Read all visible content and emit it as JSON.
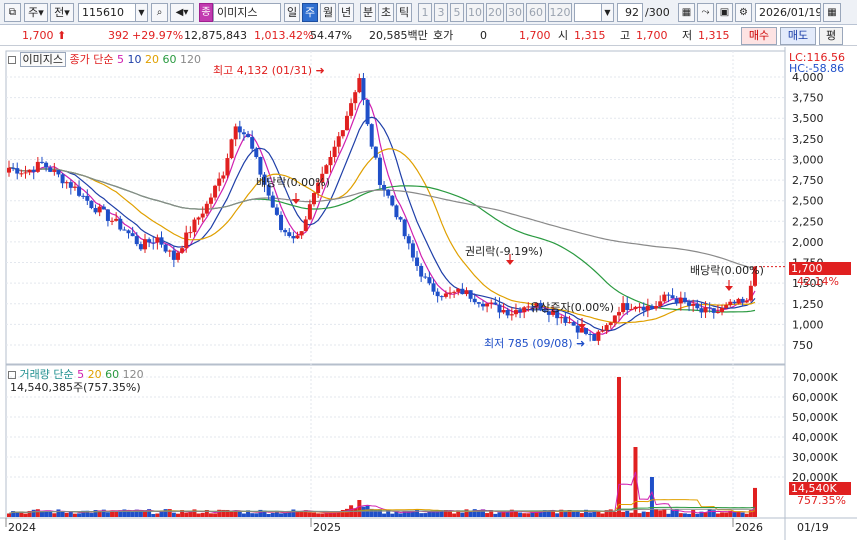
{
  "toolbar": {
    "period_label": "주",
    "market_label": "전",
    "code": "115610",
    "badge": "종",
    "stock_name": "이미지스",
    "period_tabs": [
      "일",
      "주",
      "월",
      "년",
      "분",
      "초",
      "틱"
    ],
    "selected_tab": "주",
    "num_tabs": [
      "1",
      "3",
      "5",
      "10",
      "20",
      "30",
      "60",
      "120"
    ],
    "count_value": "92",
    "count_total": "/300",
    "date": "2026/01/19"
  },
  "price_bar": {
    "price": "1,700",
    "change": "392",
    "change_pct": "+29.97%",
    "volume": "12,875,843",
    "volume_pct": "1,013.42%",
    "turnover_pct": "54.47%",
    "amount": "20,585백만",
    "quote_label": "호가",
    "quote_value": "0",
    "quote_price": "1,700",
    "open_label": "시",
    "open": "1,315",
    "high_label": "고",
    "high": "1,700",
    "low_label": "저",
    "low": "1,315",
    "buy": "매수",
    "sell": "매도",
    "flat": "평"
  },
  "price_pane": {
    "name_tag": "이미지스",
    "legend_title": "종가 단순",
    "ma_labels": [
      "5",
      "10",
      "20",
      "60",
      "120"
    ],
    "lc": "LC:116.56",
    "hc": "HC:-58.86",
    "current_price_tag": "1,700",
    "current_pct_tag": "42.14%",
    "annotations": {
      "high": "최고 4,132 (01/31)",
      "low": "최저 785 (09/08)",
      "dividend1": "배당락(0.00%)",
      "rights": "권리락(-9.19%)",
      "bonus": "유상증자(0.00%)",
      "dividend2": "배당락(0.00%)"
    },
    "y_ticks": [
      "4,000",
      "3,750",
      "3,500",
      "3,250",
      "3,000",
      "2,750",
      "2,500",
      "2,250",
      "2,000",
      "1,750",
      "1,500",
      "1,250",
      "1,000",
      "750"
    ]
  },
  "volume_pane": {
    "legend_title": "거래량",
    "legend_type": "단순",
    "ma_labels": [
      "5",
      "20",
      "60",
      "120"
    ],
    "info": "14,540,385주(757.35%)",
    "y_ticks": [
      "70,000K",
      "60,000K",
      "50,000K",
      "40,000K",
      "30,000K",
      "20,000K"
    ],
    "current_tag": "14,540K",
    "current_pct_tag": "757.35%"
  },
  "x_axis": {
    "labels": [
      "2024",
      "2025",
      "2026"
    ],
    "right_label": "01/19"
  },
  "colors": {
    "up": "#e02020",
    "down": "#1f4fc8",
    "ma5": "#d020b0",
    "ma10": "#1f3fa8",
    "ma20": "#e0a000",
    "ma60": "#2a9a40",
    "ma120": "#8a8a8a"
  },
  "icons": [
    "window-icon",
    "search-icon",
    "speaker-icon",
    "dropdown-icon",
    "link-icon",
    "grid-icon",
    "save-icon",
    "gear-icon",
    "spinner-icon"
  ]
}
